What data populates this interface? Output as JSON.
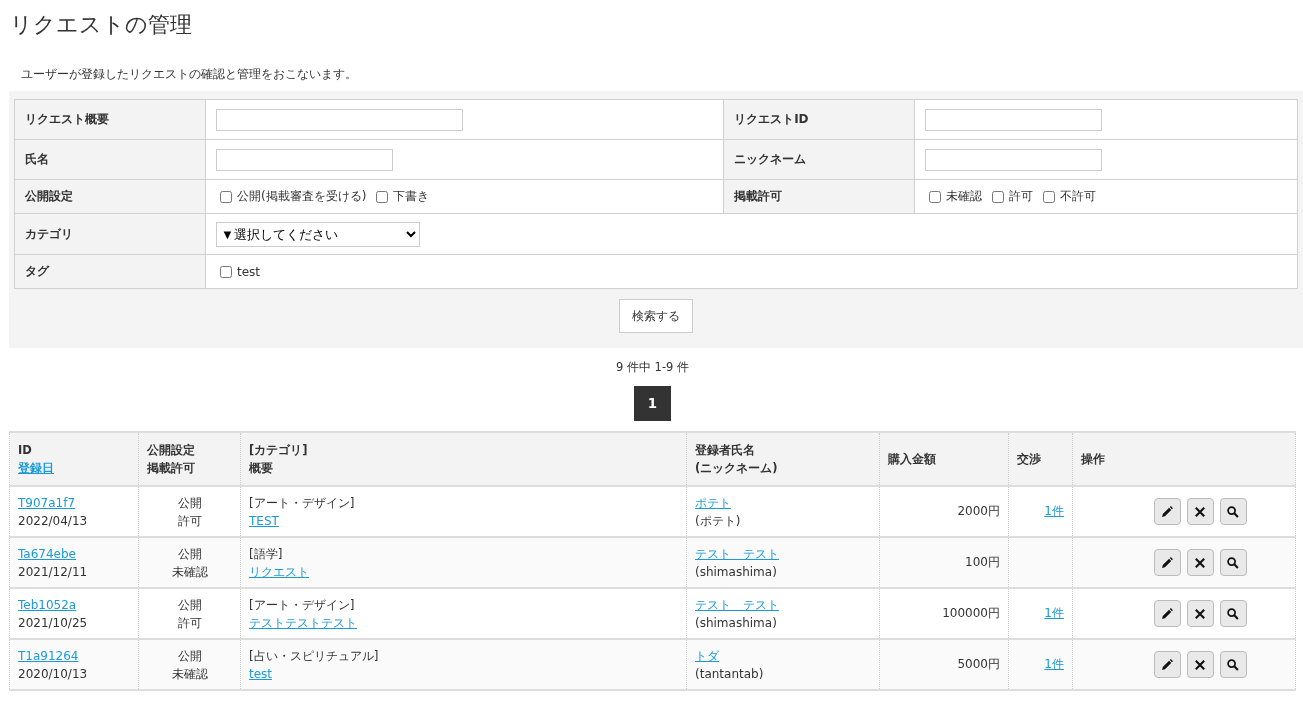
{
  "title": "リクエストの管理",
  "description": "ユーザーが登録したリクエストの確認と管理をおこないます。",
  "search_form": {
    "rows": [
      {
        "fields": [
          {
            "label": "リクエスト概要",
            "kind": "text"
          },
          {
            "label": "リクエストID",
            "kind": "text"
          }
        ]
      },
      {
        "fields": [
          {
            "label": "氏名",
            "kind": "text"
          },
          {
            "label": "ニックネーム",
            "kind": "text"
          }
        ]
      },
      {
        "fields": [
          {
            "label": "公開設定",
            "kind": "checkboxes",
            "options": [
              {
                "label": "公開(掲載審査を受ける)",
                "checked": false
              },
              {
                "label": "下書き",
                "checked": false
              }
            ]
          },
          {
            "label": "掲載許可",
            "kind": "checkboxes",
            "options": [
              {
                "label": "未確認",
                "checked": false
              },
              {
                "label": "許可",
                "checked": false
              },
              {
                "label": "不許可",
                "checked": false
              }
            ]
          }
        ]
      },
      {
        "fields": [
          {
            "label": "カテゴリ",
            "kind": "select",
            "value": "▼選択してください"
          }
        ]
      },
      {
        "fields": [
          {
            "label": "タグ",
            "kind": "checkboxes",
            "options": [
              {
                "label": "test",
                "checked": false
              }
            ]
          }
        ]
      }
    ],
    "button": "検索する"
  },
  "result_count": "9 件中 1-9 件",
  "pages": [
    {
      "label": "1",
      "selected": true
    }
  ],
  "table": {
    "columns": [
      {
        "lines": [
          "ID"
        ],
        "sort_link": "登録日"
      },
      {
        "lines": [
          "公開設定",
          "掲載許可"
        ]
      },
      {
        "lines": [
          "[カテゴリ]",
          "概要"
        ]
      },
      {
        "lines": [
          "登録者氏名",
          "(ニックネーム)"
        ]
      },
      {
        "lines": [
          "購入金額"
        ]
      },
      {
        "lines": [
          "交渉"
        ]
      },
      {
        "lines": [
          "操作"
        ]
      }
    ],
    "rows": [
      {
        "id": "T907a1f7",
        "date": "2022/04/13",
        "visibility": "公開",
        "permission": "許可",
        "category": "[アート・デザイン]",
        "summary": "TEST",
        "name": "ポテト",
        "nickname": "(ポテト)",
        "amount": "2000円",
        "negotiation": "1件"
      },
      {
        "id": "Ta674ebe",
        "date": "2021/12/11",
        "visibility": "公開",
        "permission": "未確認",
        "category": "[語学]",
        "summary": "リクエスト",
        "name": "テスト　テスト",
        "nickname": "(shimashima)",
        "amount": "100円"
      },
      {
        "id": "Teb1052a",
        "date": "2021/10/25",
        "visibility": "公開",
        "permission": "許可",
        "category": "[アート・デザイン]",
        "summary": "テストテストテスト",
        "name": "テスト　テスト",
        "nickname": "(shimashima)",
        "amount": "100000円",
        "negotiation": "1件"
      },
      {
        "id": "T1a91264",
        "date": "2020/10/13",
        "visibility": "公開",
        "permission": "未確認",
        "category": "[占い・スピリチュアル]",
        "summary": "test",
        "name": "トダ",
        "nickname": "(tantantab)",
        "amount": "5000円",
        "negotiation": "1件"
      }
    ],
    "row_actions": [
      {
        "kind": "edit"
      },
      {
        "kind": "delete"
      },
      {
        "kind": "view"
      }
    ]
  }
}
